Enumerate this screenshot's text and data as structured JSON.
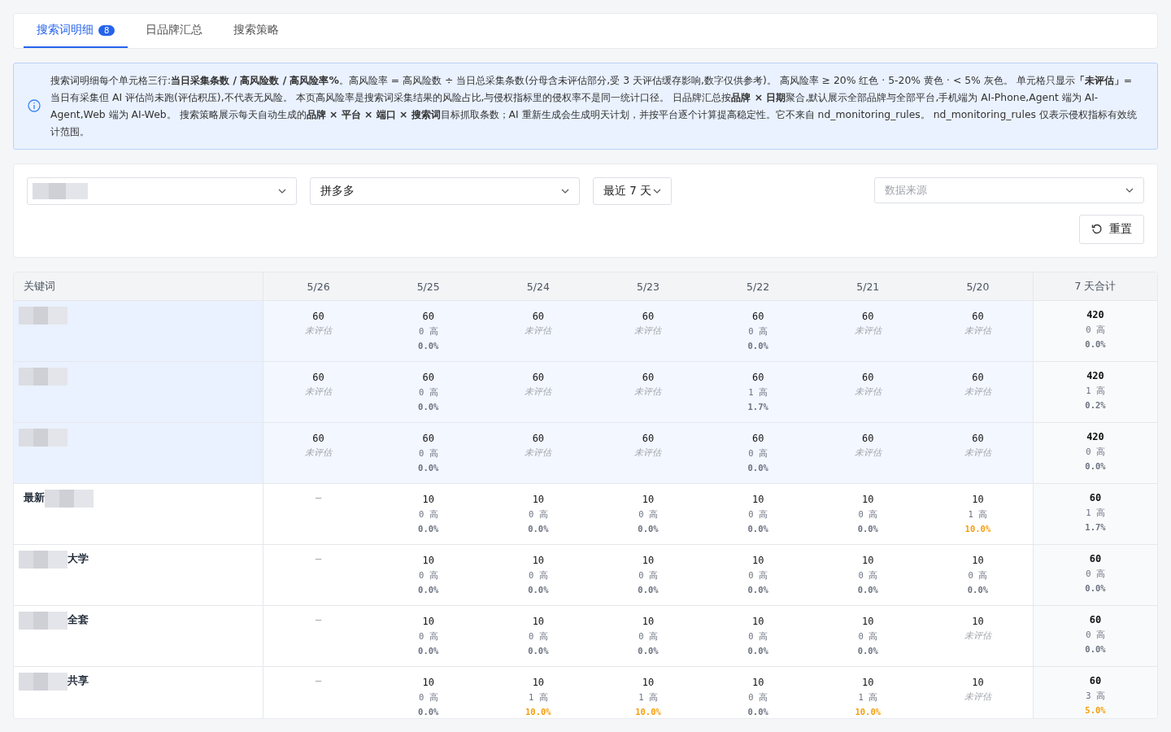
{
  "tabs": [
    {
      "label": "搜索词明细",
      "badge": "8",
      "selected": true
    },
    {
      "label": "日品牌汇总",
      "selected": false
    },
    {
      "label": "搜索策略",
      "selected": false
    }
  ],
  "info": "搜索词明细每个单元格三行:**当日采集条数 / 高风险数 / 高风险率%**。高风险率 = 高风险数 ÷ 当日总采集条数(分母含未评估部分,受 3 天评估缓存影响,数字仅供参考)。 高风险率 ≥ 20% 红色 · 5-20% 黄色 · < 5% 灰色。 单元格只显示**「未评估」**=当日有采集但 AI 评估尚未跑(评估积压),不代表无风险。 本页高风险率是搜索词采集结果的风险占比,与侵权指标里的侵权率不是同一统计口径。 日品牌汇总按**品牌 × 日期**聚合,默认展示全部品牌与全部平台,手机端为 AI-Phone,Agent 端为 AI-Agent,Web 端为 AI-Web。 搜索策略展示每天自动生成的**品牌 × 平台 × 端口 × 搜索词**目标抓取条数；AI 重新生成会生成明天计划，并按平台逐个计算提高稳定性。它不来自 nd_monitoring_rules。 nd_monitoring_rules 仅表示侵权指标有效统计范围。",
  "filters": [
    {
      "kind": "redacted"
    },
    {
      "kind": "value",
      "value": "拼多多"
    },
    {
      "kind": "value",
      "value": "最近 7 天"
    },
    {
      "kind": "placeholder",
      "placeholder": "数据来源"
    }
  ],
  "reset_button": "重置",
  "table": {
    "columns": [
      "关键词",
      "5/26",
      "5/25",
      "5/24",
      "5/23",
      "5/22",
      "5/21",
      "5/20",
      "7 天合计"
    ],
    "rows": [
      {
        "selected": true,
        "cells": [
          {
            "kind": "keyword",
            "parts": [
              {
                "kind": "redacted"
              }
            ]
          },
          {
            "kind": "pending",
            "count": "60",
            "note": "未评估"
          },
          {
            "kind": "eval",
            "count": "60",
            "high": "0 高",
            "rate": "0.0%",
            "color": "#6b7280"
          },
          {
            "kind": "pending",
            "count": "60",
            "note": "未评估"
          },
          {
            "kind": "pending",
            "count": "60",
            "note": "未评估"
          },
          {
            "kind": "eval",
            "count": "60",
            "high": "0 高",
            "rate": "0.0%",
            "color": "#6b7280"
          },
          {
            "kind": "pending",
            "count": "60",
            "note": "未评估"
          },
          {
            "kind": "pending",
            "count": "60",
            "note": "未评估"
          },
          {
            "kind": "total",
            "count": "420",
            "high": "0 高",
            "rate": "0.0%",
            "color": "#6b7280"
          }
        ]
      },
      {
        "selected": true,
        "cells": [
          {
            "kind": "keyword",
            "parts": [
              {
                "kind": "redacted"
              }
            ]
          },
          {
            "kind": "pending",
            "count": "60",
            "note": "未评估"
          },
          {
            "kind": "eval",
            "count": "60",
            "high": "0 高",
            "rate": "0.0%",
            "color": "#6b7280"
          },
          {
            "kind": "pending",
            "count": "60",
            "note": "未评估"
          },
          {
            "kind": "pending",
            "count": "60",
            "note": "未评估"
          },
          {
            "kind": "eval",
            "count": "60",
            "high": "1 高",
            "rate": "1.7%",
            "color": "#6b7280"
          },
          {
            "kind": "pending",
            "count": "60",
            "note": "未评估"
          },
          {
            "kind": "pending",
            "count": "60",
            "note": "未评估"
          },
          {
            "kind": "total",
            "count": "420",
            "high": "1 高",
            "rate": "0.2%",
            "color": "#6b7280"
          }
        ]
      },
      {
        "selected": true,
        "cells": [
          {
            "kind": "keyword",
            "parts": [
              {
                "kind": "redacted"
              }
            ]
          },
          {
            "kind": "pending",
            "count": "60",
            "note": "未评估"
          },
          {
            "kind": "eval",
            "count": "60",
            "high": "0 高",
            "rate": "0.0%",
            "color": "#6b7280"
          },
          {
            "kind": "pending",
            "count": "60",
            "note": "未评估"
          },
          {
            "kind": "pending",
            "count": "60",
            "note": "未评估"
          },
          {
            "kind": "eval",
            "count": "60",
            "high": "0 高",
            "rate": "0.0%",
            "color": "#6b7280"
          },
          {
            "kind": "pending",
            "count": "60",
            "note": "未评估"
          },
          {
            "kind": "pending",
            "count": "60",
            "note": "未评估"
          },
          {
            "kind": "total",
            "count": "420",
            "high": "0 高",
            "rate": "0.0%",
            "color": "#6b7280"
          }
        ]
      },
      {
        "selected": false,
        "cells": [
          {
            "kind": "keyword",
            "parts": [
              {
                "kind": "text",
                "text": "最新"
              },
              {
                "kind": "redacted"
              }
            ]
          },
          {
            "kind": "empty",
            "text": "—"
          },
          {
            "kind": "eval",
            "count": "10",
            "high": "0 高",
            "rate": "0.0%",
            "color": "#6b7280"
          },
          {
            "kind": "eval",
            "count": "10",
            "high": "0 高",
            "rate": "0.0%",
            "color": "#6b7280"
          },
          {
            "kind": "eval",
            "count": "10",
            "high": "0 高",
            "rate": "0.0%",
            "color": "#6b7280"
          },
          {
            "kind": "eval",
            "count": "10",
            "high": "0 高",
            "rate": "0.0%",
            "color": "#6b7280"
          },
          {
            "kind": "eval",
            "count": "10",
            "high": "0 高",
            "rate": "0.0%",
            "color": "#6b7280"
          },
          {
            "kind": "eval",
            "count": "10",
            "high": "1 高",
            "rate": "10.0%",
            "color": "#f59e0b"
          },
          {
            "kind": "total",
            "count": "60",
            "high": "1 高",
            "rate": "1.7%",
            "color": "#6b7280"
          }
        ]
      },
      {
        "selected": false,
        "cells": [
          {
            "kind": "keyword",
            "parts": [
              {
                "kind": "redacted"
              },
              {
                "kind": "text",
                "text": "大学"
              }
            ]
          },
          {
            "kind": "empty",
            "text": "—"
          },
          {
            "kind": "eval",
            "count": "10",
            "high": "0 高",
            "rate": "0.0%",
            "color": "#6b7280"
          },
          {
            "kind": "eval",
            "count": "10",
            "high": "0 高",
            "rate": "0.0%",
            "color": "#6b7280"
          },
          {
            "kind": "eval",
            "count": "10",
            "high": "0 高",
            "rate": "0.0%",
            "color": "#6b7280"
          },
          {
            "kind": "eval",
            "count": "10",
            "high": "0 高",
            "rate": "0.0%",
            "color": "#6b7280"
          },
          {
            "kind": "eval",
            "count": "10",
            "high": "0 高",
            "rate": "0.0%",
            "color": "#6b7280"
          },
          {
            "kind": "eval",
            "count": "10",
            "high": "0 高",
            "rate": "0.0%",
            "color": "#6b7280"
          },
          {
            "kind": "total",
            "count": "60",
            "high": "0 高",
            "rate": "0.0%",
            "color": "#6b7280"
          }
        ]
      },
      {
        "selected": false,
        "cells": [
          {
            "kind": "keyword",
            "parts": [
              {
                "kind": "redacted"
              },
              {
                "kind": "text",
                "text": "全套"
              }
            ]
          },
          {
            "kind": "empty",
            "text": "—"
          },
          {
            "kind": "eval",
            "count": "10",
            "high": "0 高",
            "rate": "0.0%",
            "color": "#6b7280"
          },
          {
            "kind": "eval",
            "count": "10",
            "high": "0 高",
            "rate": "0.0%",
            "color": "#6b7280"
          },
          {
            "kind": "eval",
            "count": "10",
            "high": "0 高",
            "rate": "0.0%",
            "color": "#6b7280"
          },
          {
            "kind": "eval",
            "count": "10",
            "high": "0 高",
            "rate": "0.0%",
            "color": "#6b7280"
          },
          {
            "kind": "eval",
            "count": "10",
            "high": "0 高",
            "rate": "0.0%",
            "color": "#6b7280"
          },
          {
            "kind": "pending",
            "count": "10",
            "note": "未评估"
          },
          {
            "kind": "total",
            "count": "60",
            "high": "0 高",
            "rate": "0.0%",
            "color": "#6b7280"
          }
        ]
      },
      {
        "selected": false,
        "cells": [
          {
            "kind": "keyword",
            "parts": [
              {
                "kind": "redacted"
              },
              {
                "kind": "text",
                "text": "共享"
              }
            ]
          },
          {
            "kind": "empty",
            "text": "—"
          },
          {
            "kind": "eval",
            "count": "10",
            "high": "0 高",
            "rate": "0.0%",
            "color": "#6b7280"
          },
          {
            "kind": "eval",
            "count": "10",
            "high": "1 高",
            "rate": "10.0%",
            "color": "#f59e0b"
          },
          {
            "kind": "eval",
            "count": "10",
            "high": "1 高",
            "rate": "10.0%",
            "color": "#f59e0b"
          },
          {
            "kind": "eval",
            "count": "10",
            "high": "0 高",
            "rate": "0.0%",
            "color": "#6b7280"
          },
          {
            "kind": "eval",
            "count": "10",
            "high": "1 高",
            "rate": "10.0%",
            "color": "#f59e0b"
          },
          {
            "kind": "pending",
            "count": "10",
            "note": "未评估"
          },
          {
            "kind": "total",
            "count": "60",
            "high": "3 高",
            "rate": "5.0%",
            "color": "#f59e0b"
          }
        ]
      }
    ]
  }
}
